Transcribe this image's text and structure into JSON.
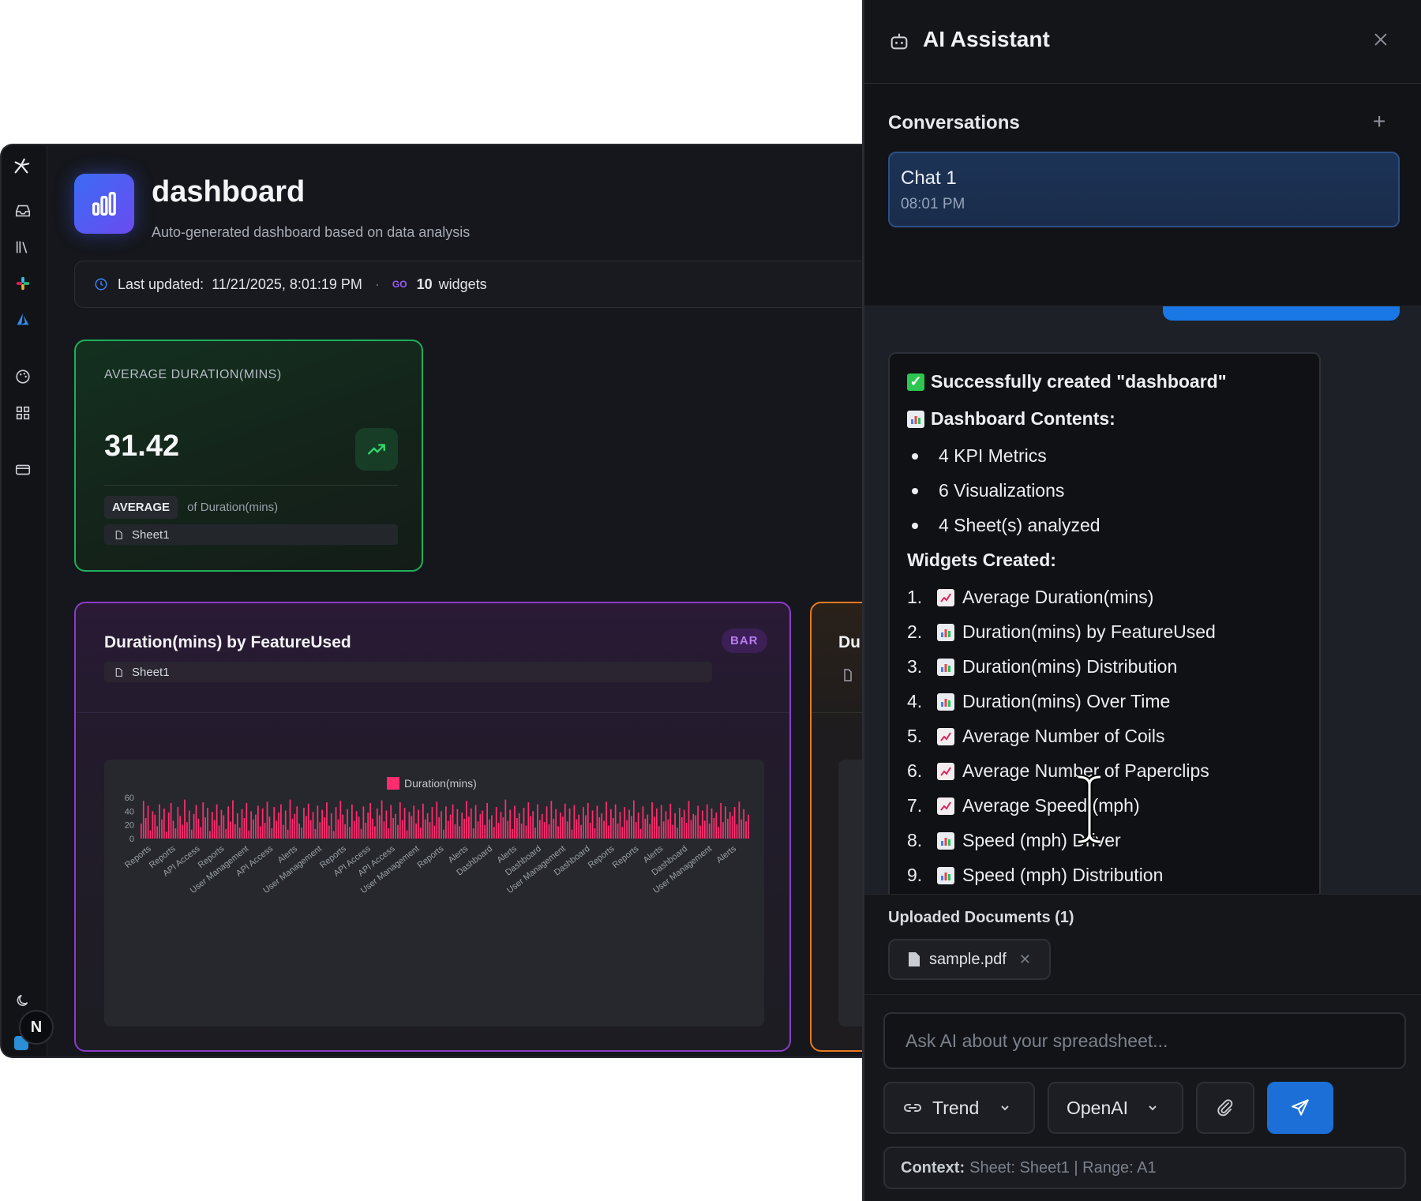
{
  "dashboard": {
    "title": "dashboard",
    "subtitle": "Auto-generated dashboard based on data analysis",
    "last_updated_label": "Last updated:",
    "last_updated_value": "11/21/2025, 8:01:19 PM",
    "widget_count": "10",
    "widgets_label": "widgets"
  },
  "kpi": {
    "title": "AVERAGE DURATION(MINS)",
    "value": "31.42",
    "aggregation": "AVERAGE",
    "of_label": "of Duration(mins)",
    "sheet": "Sheet1"
  },
  "bar_widget": {
    "title": "Duration(mins) by FeatureUsed",
    "badge": "BAR",
    "sheet": "Sheet1"
  },
  "partial_widget": {
    "title": "Du"
  },
  "chart_data": {
    "type": "bar",
    "legend": [
      "Duration(mins)"
    ],
    "series_color": "#ff2d6f",
    "ylim": [
      0,
      60
    ],
    "yticks": [
      0,
      20,
      40,
      60
    ],
    "xtick_labels": [
      "Reports",
      "Reports",
      "API Access",
      "Reports",
      "User Management",
      "API Access",
      "Alerts",
      "User Management",
      "Reports",
      "API Access",
      "API Access",
      "User Management",
      "Reports",
      "Alerts",
      "Dashboard",
      "Alerts",
      "Dashboard",
      "User Management",
      "Dashboard",
      "Reports",
      "Reports",
      "Alerts",
      "Dashboard",
      "User Management",
      "Alerts"
    ],
    "values": [
      22,
      55,
      30,
      48,
      12,
      40,
      35,
      18,
      50,
      28,
      44,
      10,
      38,
      52,
      26,
      15,
      46,
      33,
      20,
      57,
      24,
      41,
      13,
      36,
      49,
      29,
      17,
      53,
      31,
      45,
      11,
      39,
      27,
      50,
      19,
      42,
      34,
      14,
      47,
      25,
      56,
      21,
      37,
      16,
      43,
      30,
      52,
      12,
      40,
      28,
      35,
      48,
      18,
      44,
      23,
      54,
      32,
      15,
      46,
      26,
      38,
      50,
      20,
      41,
      13,
      57,
      29,
      36,
      47,
      22,
      16,
      45,
      33,
      51,
      27,
      39,
      14,
      48,
      24,
      42,
      31,
      53,
      19,
      37,
      11,
      46,
      28,
      55,
      35,
      21,
      43,
      17,
      50,
      26,
      40,
      32,
      14,
      47,
      23,
      38,
      52,
      29,
      18,
      44,
      34,
      56,
      25,
      41,
      15,
      49,
      30,
      36,
      20,
      53,
      27,
      45,
      12,
      39,
      33,
      48,
      22,
      42,
      16,
      51,
      28,
      37,
      24,
      46,
      19,
      54,
      31,
      40,
      13,
      47,
      26,
      35,
      50,
      21,
      43,
      18,
      38,
      29,
      55,
      32,
      44,
      15,
      49,
      25,
      36,
      41,
      20,
      52,
      28,
      34,
      17,
      46,
      23,
      39,
      31,
      57,
      26,
      42,
      14,
      48,
      30,
      37,
      22,
      45,
      19,
      53,
      33,
      40,
      16,
      50,
      27,
      36,
      24,
      47,
      21,
      55,
      29,
      43,
      18,
      38,
      32,
      51,
      25,
      44,
      13,
      49,
      28,
      35,
      20,
      46,
      34,
      52,
      23,
      41,
      15,
      48,
      31,
      37,
      26,
      54,
      19,
      43,
      30,
      50,
      22,
      39,
      17,
      46,
      27,
      42,
      33,
      56,
      24,
      38,
      14,
      47,
      29,
      35,
      21,
      53,
      32,
      44,
      18,
      49,
      25,
      40,
      28,
      51,
      20,
      37,
      16,
      45,
      31,
      42,
      23,
      55,
      27,
      36,
      34,
      48,
      19,
      41,
      26,
      50,
      22,
      44,
      30,
      38,
      17,
      52,
      24,
      47,
      29,
      39,
      33,
      46,
      21,
      54,
      28,
      43,
      25,
      35
    ]
  },
  "assistant": {
    "title": "AI Assistant",
    "conversations_label": "Conversations",
    "chat_name": "Chat 1",
    "chat_time": "08:01 PM",
    "message": {
      "success": "Successfully created \"dashboard\"",
      "contents_heading": "Dashboard Contents:",
      "contents": [
        "4 KPI Metrics",
        "6 Visualizations",
        "4 Sheet(s) analyzed"
      ],
      "widgets_heading": "Widgets Created:",
      "widgets": [
        {
          "num": "1.",
          "icon": "trend",
          "label": "Average Duration(mins)"
        },
        {
          "num": "2.",
          "icon": "chart",
          "label": "Duration(mins) by FeatureUsed"
        },
        {
          "num": "3.",
          "icon": "chart",
          "label": "Duration(mins) Distribution"
        },
        {
          "num": "4.",
          "icon": "chart",
          "label": "Duration(mins) Over Time"
        },
        {
          "num": "5.",
          "icon": "trend",
          "label": "Average Number of Coils"
        },
        {
          "num": "6.",
          "icon": "trend",
          "label": "Average Number of Paperclips"
        },
        {
          "num": "7.",
          "icon": "trend",
          "label": "Average Speed (mph)"
        },
        {
          "num": "8.",
          "icon": "chart",
          "label": "Speed (mph) Driver"
        },
        {
          "num": "9.",
          "icon": "chart",
          "label": "Speed (mph) Distribution"
        }
      ]
    },
    "docs_label": "Uploaded Documents (1)",
    "doc_name": "sample.pdf",
    "input_placeholder": "Ask AI about your spreadsheet...",
    "mode": "Trend",
    "model": "OpenAI",
    "context_label": "Context:",
    "context_value": "Sheet: Sheet1 | Range: A1"
  }
}
